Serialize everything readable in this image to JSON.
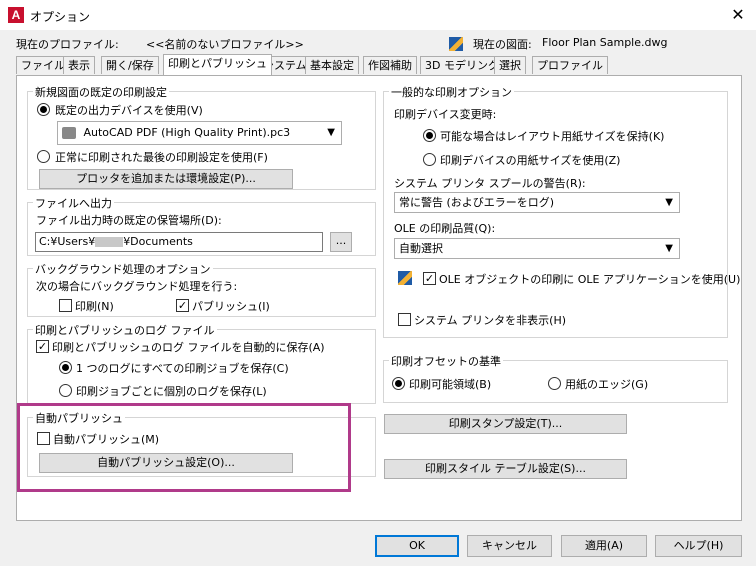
{
  "window": {
    "title": "オプション",
    "app_icon_letter": "A",
    "close_glyph": "✕"
  },
  "info": {
    "profile_label": "現在のプロファイル:",
    "profile_value": "<<名前のないプロファイル>>",
    "drawing_label": "現在の図面:",
    "drawing_value": "Floor Plan Sample.dwg"
  },
  "tabs": [
    "ファイル",
    "表示",
    "開く/保存",
    "印刷とパブリッシュ",
    "システム",
    "基本設定",
    "作図補助",
    "3D モデリング",
    "選択",
    "プロファイル"
  ],
  "active_tab": "印刷とパブリッシュ",
  "left": {
    "default_output": {
      "title": "新規図面の既定の印刷設定",
      "opt_default_device": "既定の出力デバイスを使用(V)",
      "device_value": "AutoCAD PDF (High Quality Print).pc3",
      "opt_last_used": "正常に印刷された最後の印刷設定を使用(F)",
      "add_plotter_button": "プロッタを追加または環境設定(P)..."
    },
    "file_output": {
      "title": "ファイルへ出力",
      "location_label": "ファイル出力時の既定の保管場所(D):",
      "path_prefix": "C:¥Users¥",
      "path_suffix": "¥Documents",
      "browse_button": "..."
    },
    "background": {
      "title": "バックグラウンド処理のオプション",
      "intro": "次の場合にバックグラウンド処理を行う:",
      "plot_label": "印刷(N)",
      "publish_label": "パブリッシュ(I)",
      "plot_checked": false,
      "publish_checked": true
    },
    "log": {
      "title": "印刷とパブリッシュのログ ファイル",
      "auto_save_label": "印刷とパブリッシュのログ ファイルを自動的に保存(A)",
      "auto_save_checked": true,
      "opt_continuous": "1 つのログにすべての印刷ジョブを保存(C)",
      "opt_per_job": "印刷ジョブごとに個別のログを保存(L)"
    },
    "auto_publish": {
      "title": "自動パブリッシュ",
      "checkbox_label": "自動パブリッシュ(M)",
      "checked": false,
      "settings_button": "自動パブリッシュ設定(O)..."
    }
  },
  "right": {
    "general": {
      "title": "一般的な印刷オプション",
      "device_change_label": "印刷デバイス変更時:",
      "opt_keep_layout": "可能な場合はレイアウト用紙サイズを保持(K)",
      "opt_use_device": "印刷デバイスの用紙サイズを使用(Z)",
      "spool_label": "システム プリンタ スプールの警告(R):",
      "spool_value": "常に警告 (およびエラーをログ)",
      "ole_quality_label": "OLE の印刷品質(Q):",
      "ole_quality_value": "自動選択",
      "ole_app_label": "OLE オブジェクトの印刷に OLE アプリケーションを使用(U)",
      "ole_app_checked": true,
      "hide_printers_label": "システム プリンタを非表示(H)",
      "hide_printers_checked": false
    },
    "offset": {
      "title": "印刷オフセットの基準",
      "opt_printable": "印刷可能領域(B)",
      "opt_edge": "用紙のエッジ(G)"
    },
    "stamp_button": "印刷スタンプ設定(T)...",
    "style_table_button": "印刷スタイル テーブル設定(S)..."
  },
  "footer": {
    "ok": "OK",
    "cancel": "キャンセル",
    "apply": "適用(A)",
    "help": "ヘルプ(H)"
  },
  "colors": {
    "highlight": "#b03a8a",
    "accent": "#0078d7"
  }
}
